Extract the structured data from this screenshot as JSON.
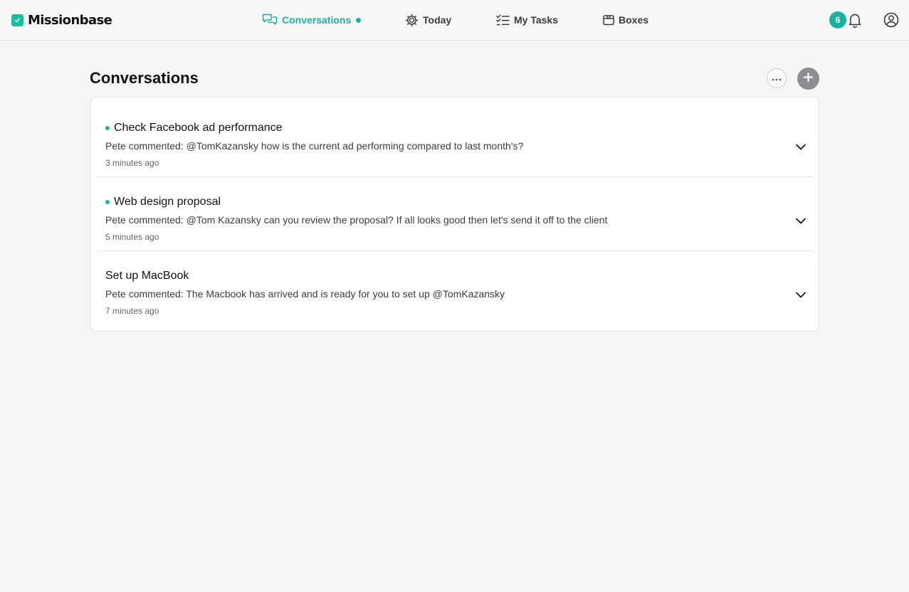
{
  "app": {
    "brand": "Missionbase"
  },
  "nav": {
    "items": [
      {
        "label": "Conversations",
        "icon": "chat-bubbles-icon",
        "active": true
      },
      {
        "label": "Today",
        "icon": "sun-icon",
        "active": false
      },
      {
        "label": "My Tasks",
        "icon": "checklist-icon",
        "active": false
      },
      {
        "label": "Boxes",
        "icon": "box-icon",
        "active": false
      }
    ]
  },
  "header": {
    "notification_count": "6"
  },
  "page": {
    "title": "Conversations"
  },
  "conversations": [
    {
      "title": "Check Facebook ad performance",
      "unread": true,
      "comment": "Pete commented: @TomKazansky how is the current ad performing compared to last month's?",
      "time": "3 minutes ago"
    },
    {
      "title": "Web design proposal",
      "unread": true,
      "comment": "Pete commented: @Tom Kazansky can you review the proposal? If all looks good then let's send it off to the client",
      "time": "5 minutes ago"
    },
    {
      "title": "Set up MacBook",
      "unread": false,
      "comment": "Pete commented: The Macbook has arrived and is ready for you to set up @TomKazansky",
      "time": "7 minutes ago"
    }
  ],
  "colors": {
    "accent": "#17b3a1",
    "add_button": "#8d8d92"
  }
}
